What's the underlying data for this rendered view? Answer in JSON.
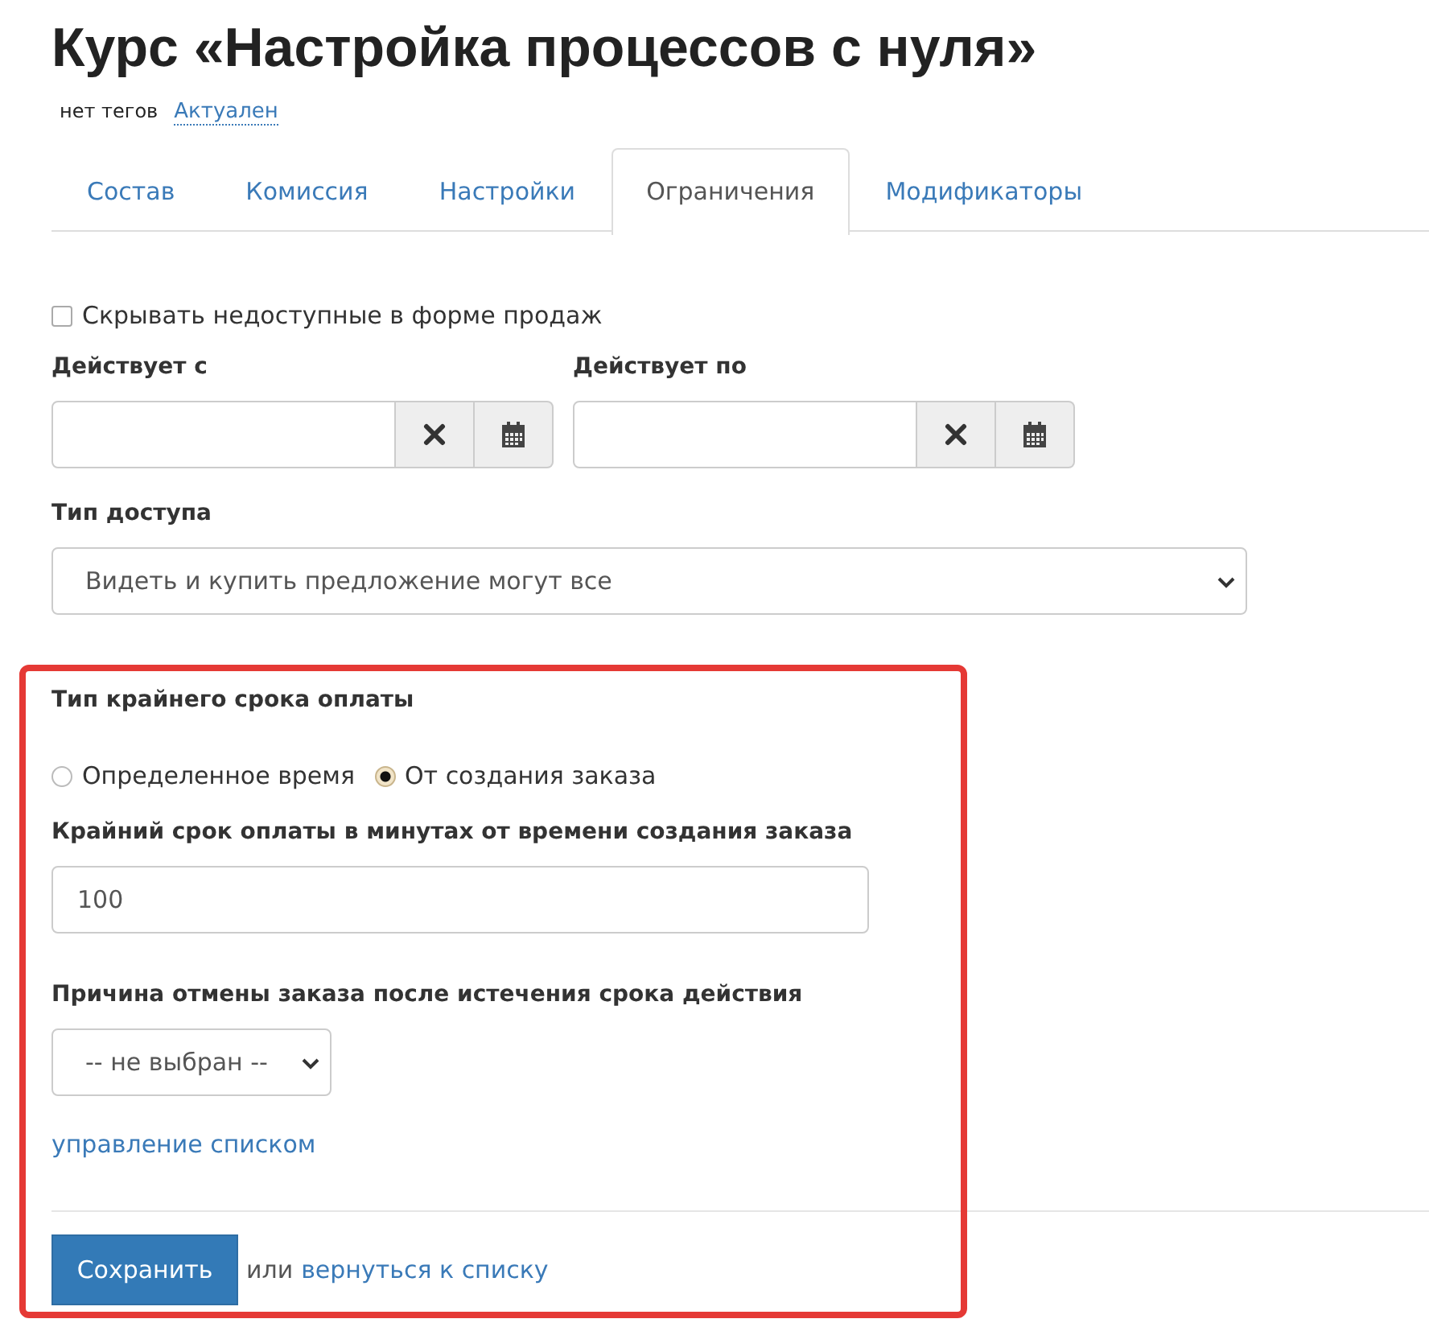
{
  "title": "Курс «Настройка процессов с нуля»",
  "tags_text": "нет тегов",
  "status_link": "Актуален",
  "tabs": [
    {
      "label": "Состав",
      "selected": false
    },
    {
      "label": "Комиссия",
      "selected": false
    },
    {
      "label": "Настройки",
      "selected": false
    },
    {
      "label": "Ограничения",
      "selected": true
    },
    {
      "label": "Модификаторы",
      "selected": false
    }
  ],
  "hide_checkbox": {
    "label": "Скрывать недоступные в форме продаж",
    "checked": false
  },
  "date_fields": [
    {
      "label": "Действует с"
    },
    {
      "label": "Действует по"
    }
  ],
  "access_type": {
    "label": "Тип доступа",
    "value": "Видеть и купить предложение могут все"
  },
  "deadline_type": {
    "label": "Тип крайнего срока оплаты",
    "options": [
      {
        "label": "Определенное время",
        "selected": false
      },
      {
        "label": "От создания заказа",
        "selected": true
      }
    ]
  },
  "deadline_minutes": {
    "label": "Крайний срок оплаты в минутах от времени создания заказа",
    "value": "100"
  },
  "cancel_reason": {
    "label": "Причина отмены заказа после истечения срока действия",
    "value": "-- не выбран --"
  },
  "manage_link": "управление списком",
  "save_button": "Сохранить",
  "or_text": "или",
  "back_link": "вернуться к списку",
  "highlight": true
}
